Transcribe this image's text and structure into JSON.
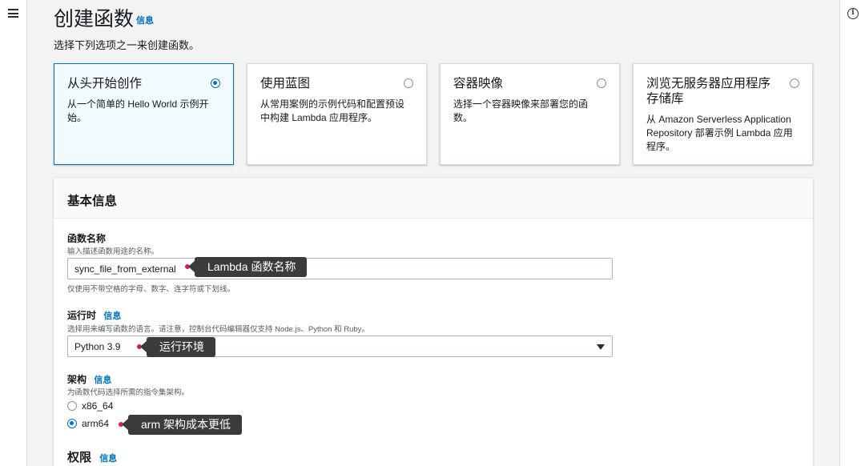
{
  "header": {
    "title": "创建函数",
    "title_info": "信息",
    "subtitle": "选择下列选项之一来创建函数。"
  },
  "options": [
    {
      "title": "从头开始创作",
      "desc": "从一个简单的 Hello World 示例开始。",
      "selected": true
    },
    {
      "title": "使用蓝图",
      "desc": "从常用案例的示例代码和配置预设中构建 Lambda 应用程序。",
      "selected": false
    },
    {
      "title": "容器映像",
      "desc": "选择一个容器映像来部署您的函数。",
      "selected": false
    },
    {
      "title": "浏览无服务器应用程序存储库",
      "desc": "从 Amazon Serverless Application Repository 部署示例 Lambda 应用程序。",
      "selected": false
    }
  ],
  "basic_info": {
    "title": "基本信息",
    "function_name": {
      "label": "函数名称",
      "desc": "输入描述函数用途的名称。",
      "value": "sync_file_from_external",
      "hint": "仅使用不带空格的字母、数字、连字符或下划线。"
    },
    "runtime": {
      "label": "运行时",
      "info": "信息",
      "desc": "选择用来编写函数的语言。请注意，控制台代码编辑器仅支持 Node.js、Python 和 Ruby。",
      "value": "Python 3.9"
    },
    "architecture": {
      "label": "架构",
      "info": "信息",
      "desc": "为函数代码选择所需的指令集架构。",
      "options": [
        "x86_64",
        "arm64"
      ],
      "selected": "arm64"
    },
    "permissions": {
      "label": "权限",
      "info": "信息"
    }
  },
  "annotations": {
    "function_name": "Lambda 函数名称",
    "runtime": "运行环境",
    "architecture": "arm 架构成本更低"
  },
  "colors": {
    "accent": "#0073bb",
    "annotation_bg": "#3b3b3b",
    "annotation_dot": "#d81b60"
  }
}
